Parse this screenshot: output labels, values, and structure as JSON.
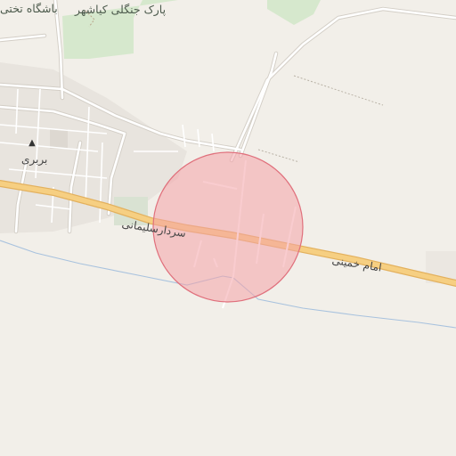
{
  "map": {
    "labels": {
      "park": "پارک جنگلی کیاشهر",
      "club": "باشگاه تختی",
      "town": "بربری",
      "road_west": "سردارسلیمانی",
      "road_east": "امام خمینی"
    },
    "icons": {
      "town_marker": "place-of-worship-icon"
    },
    "colors": {
      "land": "#f2efe9",
      "park": "#cfe6c4",
      "main_road": "#f6cf82",
      "main_road_casing": "#e3b15e",
      "minor_road": "#ffffff",
      "minor_road_casing": "#d8d3cb",
      "water": "#9ab8d8",
      "built_area": "#e4e0da",
      "radius_fill": "#f4a2a8",
      "radius_stroke": "#e0707c"
    }
  }
}
